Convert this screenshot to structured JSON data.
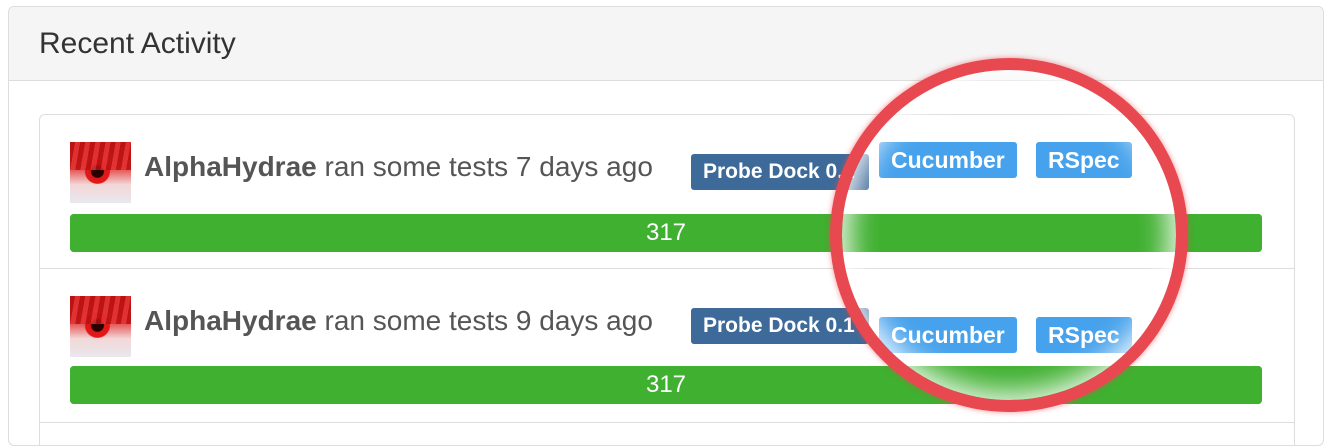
{
  "panel": {
    "title": "Recent Activity"
  },
  "activities": [
    {
      "user": "AlphaHydrae",
      "action": "ran some tests 7 days ago",
      "project": "Probe Dock 0.1",
      "categories": [
        "Cucumber",
        "RSpec"
      ],
      "result_count": "317",
      "pass_fraction": 1.0
    },
    {
      "user": "AlphaHydrae",
      "action": "ran some tests 9 days ago",
      "project": "Probe Dock 0.1",
      "categories": [
        "Cucumber",
        "RSpec"
      ],
      "result_count": "317",
      "pass_fraction": 1.0
    }
  ],
  "colors": {
    "success": "#3fb030",
    "project_tag": "#3d6a99",
    "category_tag": "#46a2ec",
    "annotation": "#e8484f"
  },
  "icons": {
    "avatar": "user-avatar-image"
  }
}
